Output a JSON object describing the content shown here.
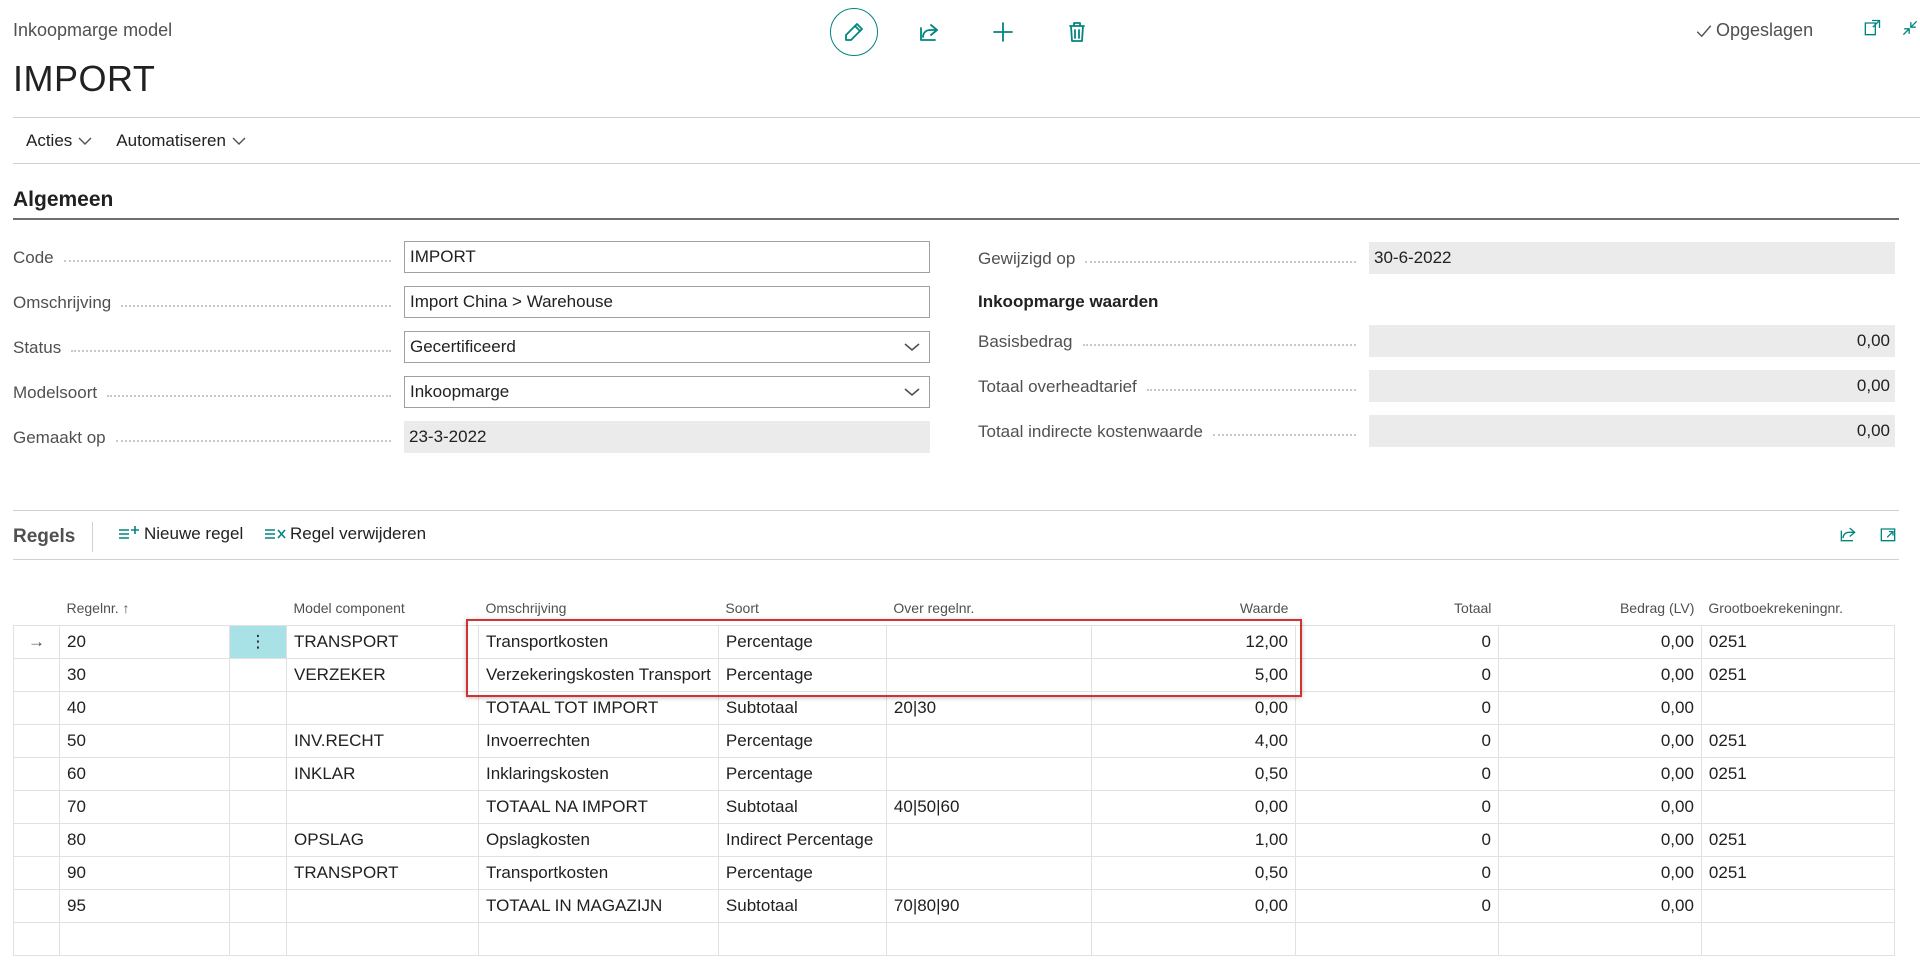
{
  "header": {
    "caption": "Inkoopmarge model",
    "title": "IMPORT",
    "saved_label": "Opgeslagen"
  },
  "menu": {
    "actions": "Acties",
    "automate": "Automatiseren"
  },
  "general": {
    "title": "Algemeen",
    "code_label": "Code",
    "code_value": "IMPORT",
    "description_label": "Omschrijving",
    "description_value": "Import China > Warehouse",
    "status_label": "Status",
    "status_value": "Gecertificeerd",
    "model_type_label": "Modelsoort",
    "model_type_value": "Inkoopmarge",
    "created_label": "Gemaakt op",
    "created_value": "23-3-2022",
    "modified_label": "Gewijzigd op",
    "modified_value": "30-6-2022",
    "values_title": "Inkoopmarge waarden",
    "base_amount_label": "Basisbedrag",
    "base_amount_value": "0,00",
    "overhead_label": "Totaal overheadtarief",
    "overhead_value": "0,00",
    "indirect_label": "Totaal indirecte kostenwaarde",
    "indirect_value": "0,00"
  },
  "lines": {
    "title": "Regels",
    "new_line": "Nieuwe regel",
    "delete_line": "Regel verwijderen",
    "columns": {
      "line_no": "Regelnr. ↑",
      "component": "Model component",
      "description": "Omschrijving",
      "type": "Soort",
      "over_line": "Over regelnr.",
      "value": "Waarde",
      "total": "Totaal",
      "amount": "Bedrag (LV)",
      "gl_account": "Grootboekrekeningnr."
    },
    "rows": [
      {
        "line_no": "20",
        "component": "TRANSPORT",
        "description": "Transportkosten",
        "type": "Percentage",
        "over_line": "",
        "value": "12,00",
        "total": "0",
        "amount": "0,00",
        "gl_account": "0251"
      },
      {
        "line_no": "30",
        "component": "VERZEKER",
        "description": "Verzekeringskosten Transport",
        "type": "Percentage",
        "over_line": "",
        "value": "5,00",
        "total": "0",
        "amount": "0,00",
        "gl_account": "0251"
      },
      {
        "line_no": "40",
        "component": "",
        "description": "TOTAAL TOT IMPORT",
        "type": "Subtotaal",
        "over_line": "20|30",
        "value": "0,00",
        "total": "0",
        "amount": "0,00",
        "gl_account": ""
      },
      {
        "line_no": "50",
        "component": "INV.RECHT",
        "description": "Invoerrechten",
        "type": "Percentage",
        "over_line": "",
        "value": "4,00",
        "total": "0",
        "amount": "0,00",
        "gl_account": "0251"
      },
      {
        "line_no": "60",
        "component": "INKLAR",
        "description": "Inklaringskosten",
        "type": "Percentage",
        "over_line": "",
        "value": "0,50",
        "total": "0",
        "amount": "0,00",
        "gl_account": "0251"
      },
      {
        "line_no": "70",
        "component": "",
        "description": "TOTAAL NA IMPORT",
        "type": "Subtotaal",
        "over_line": "40|50|60",
        "value": "0,00",
        "total": "0",
        "amount": "0,00",
        "gl_account": ""
      },
      {
        "line_no": "80",
        "component": "OPSLAG",
        "description": "Opslagkosten",
        "type": "Indirect Percentage",
        "over_line": "",
        "value": "1,00",
        "total": "0",
        "amount": "0,00",
        "gl_account": "0251"
      },
      {
        "line_no": "90",
        "component": "TRANSPORT",
        "description": "Transportkosten",
        "type": "Percentage",
        "over_line": "",
        "value": "0,50",
        "total": "0",
        "amount": "0,00",
        "gl_account": "0251"
      },
      {
        "line_no": "95",
        "component": "",
        "description": "TOTAAL IN MAGAZIJN",
        "type": "Subtotaal",
        "over_line": "70|80|90",
        "value": "0,00",
        "total": "0",
        "amount": "0,00",
        "gl_account": ""
      }
    ]
  }
}
